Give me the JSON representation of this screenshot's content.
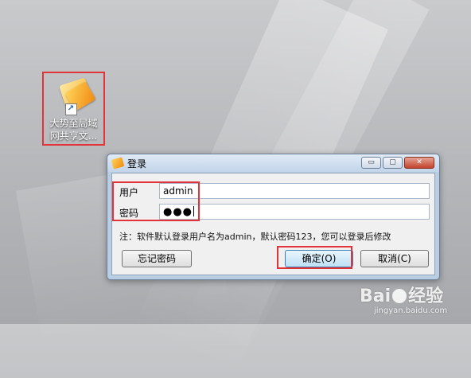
{
  "desktop": {
    "shortcut_caption": "大势至局域\n网共享文...",
    "highlight_color": "#e2333a"
  },
  "dialog": {
    "title": "登录",
    "window_buttons": {
      "minimize": "▭",
      "maximize": "▢",
      "close": "✕"
    },
    "username_label": "用户",
    "username_value": "admin",
    "password_label": "密码",
    "password_value": "●●●",
    "note": "注：软件默认登录用户名为admin，默认密码123，您可以登录后修改",
    "forgot_password_label": "忘记密码",
    "ok_label": "确定(O)",
    "cancel_label": "取消(C)"
  },
  "watermark": {
    "logo": "Bai",
    "logo_suffix": "经验",
    "url": "jingyan.baidu.com"
  }
}
